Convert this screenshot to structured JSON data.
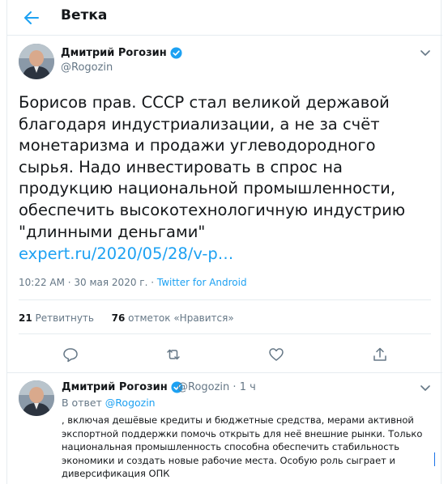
{
  "header": {
    "title": "Ветка",
    "back_icon": "arrow-left-icon"
  },
  "tweet": {
    "author_name": "Дмитрий Рогозин",
    "author_handle": "@Rogozin",
    "text": "Борисов прав. СССР стал великой державой благодаря индустриализации, а не за счёт монетаризма и продажи углеводородного сырья. Надо инвестировать в спрос на продукцию национальной промышленности, обеспечить высокотехнологичную индустрию \"длинными деньгами\"",
    "link": "expert.ru/2020/05/28/v-p…",
    "time": "10:22 AM · 30 мая 2020 г. · ",
    "source": "Twitter for Android",
    "retweet_count": "21",
    "retweet_label": " Ретвитнуть",
    "like_count": "76",
    "like_label": " отметок «Нравится»"
  },
  "reply": {
    "author_name": "Дмитрий Рогозин",
    "author_handle": "@Rogozin",
    "age": "1 ч",
    "separator": " · ",
    "reply_to_prefix": "В ответ ",
    "reply_to_handle": "@Rogozin",
    "text": ", включая дешёвые кредиты и бюджетные средства, мерами активной экспортной поддержки помочь открыть для неё внешние рынки. Только национальная промышленность способна обеспечить стабильность экономики и создать новые рабочие места. Особую роль сыграет и диверсификация ОПК"
  },
  "colors": {
    "accent": "#1da1f2",
    "text": "#14171a",
    "secondary": "#657786",
    "border": "#e6ecf0"
  },
  "icons": [
    "arrow-left-icon",
    "verified-badge-icon",
    "chevron-down-icon",
    "reply-icon",
    "retweet-icon",
    "like-icon",
    "share-icon"
  ]
}
